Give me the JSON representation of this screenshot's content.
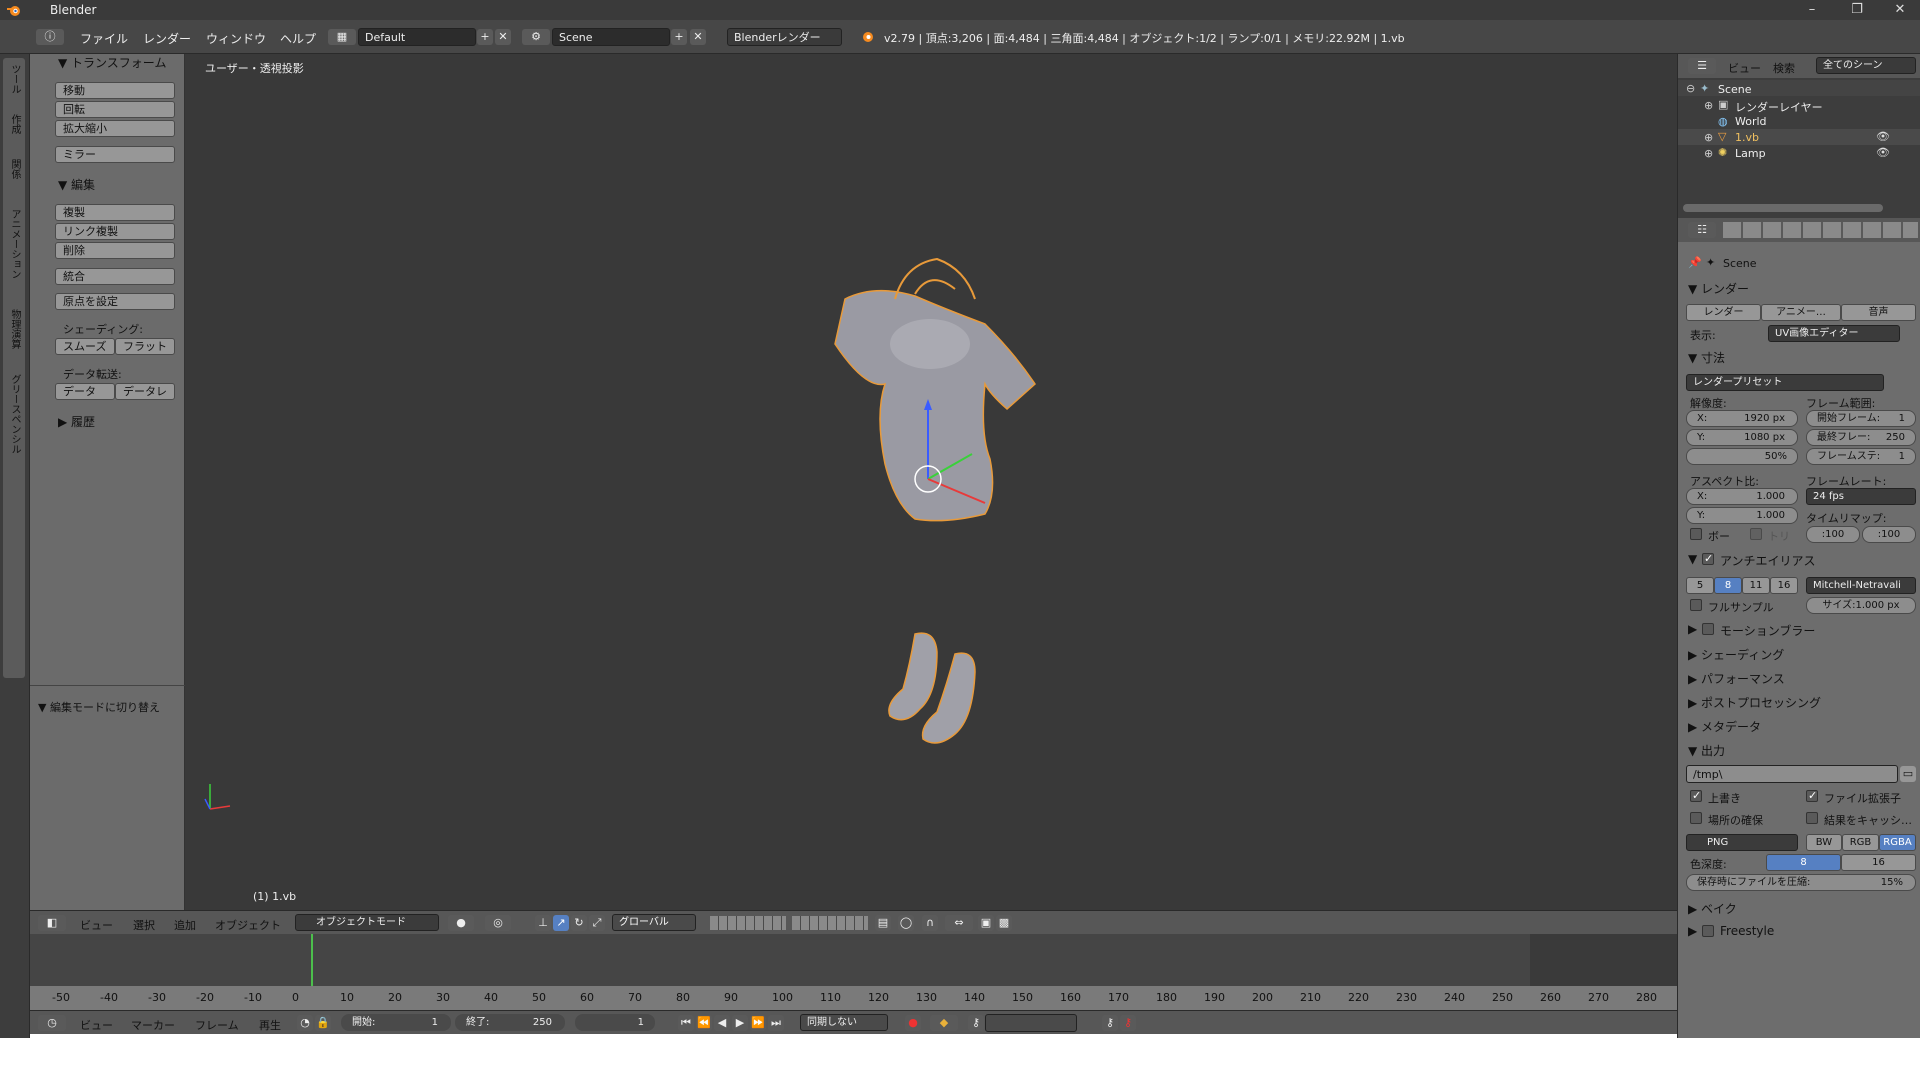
{
  "titlebar": {
    "app": "Blender",
    "min": "–",
    "max": "❐",
    "close": "✕"
  },
  "info": {
    "menus": [
      "ファイル",
      "レンダー",
      "ウィンドウ",
      "ヘルプ"
    ],
    "layout": "Default",
    "scene": "Scene",
    "engine": "Blenderレンダー",
    "stats": "v2.79 | 頂点:3,206 | 面:4,484 | 三角面:4,484 | オブジェクト:1/2 | ランプ:0/1 | メモリ:22.92M | 1.vb"
  },
  "leftstrip": {
    "tabs": [
      "ツール",
      "作成",
      "関係",
      "アニメーション",
      "物理演算",
      "グリースペンシル"
    ]
  },
  "toolshelf": {
    "transform_header": "▼ トランスフォーム",
    "transform": [
      "移動",
      "回転",
      "拡大縮小",
      "ミラー"
    ],
    "edit_header": "▼ 編集",
    "edit": [
      "複製",
      "リンク複製",
      "削除",
      "統合"
    ],
    "origin": "原点を設定",
    "shading_label": "シェーディング:",
    "smooth": "スムーズ",
    "flat": "フラット",
    "datatransfer_label": "データ転送:",
    "data": "データ",
    "data2": "データレ",
    "history": "▶ 履歴",
    "editmode": "▼ 編集モードに切り替え"
  },
  "viewport": {
    "label": "ユーザー・透視投影",
    "object": "(1) 1.vb"
  },
  "vphead": {
    "menus": [
      "ビュー",
      "選択",
      "追加",
      "オブジェクト"
    ],
    "mode": "オブジェクトモード",
    "orientation": "グローバル"
  },
  "timeline": {
    "ticks": [
      "-50",
      "-40",
      "-30",
      "-20",
      "-10",
      "0",
      "10",
      "20",
      "30",
      "40",
      "50",
      "60",
      "70",
      "80",
      "90",
      "100",
      "110",
      "120",
      "130",
      "140",
      "150",
      "160",
      "170",
      "180",
      "190",
      "200",
      "210",
      "220",
      "230",
      "240",
      "250",
      "260",
      "270",
      "280"
    ]
  },
  "tlfoot": {
    "menus": [
      "ビュー",
      "マーカー",
      "フレーム",
      "再生"
    ],
    "start_label": "開始:",
    "start": "1",
    "end_label": "終了:",
    "end": "250",
    "current": "1",
    "sync": "同期しない"
  },
  "outliner": {
    "menus": [
      "ビュー",
      "検索",
      "全てのシーン"
    ],
    "items": [
      "Scene",
      "レンダーレイヤー",
      "World",
      "1.vb",
      "Lamp"
    ]
  },
  "props": {
    "scene": "Scene",
    "render": "▼ レンダー",
    "render_btns": [
      "レンダー",
      "アニメー…",
      "音声"
    ],
    "display_label": "表示:",
    "display": "UV画像エディター",
    "dimensions": "▼ 寸法",
    "preset": "レンダープリセット",
    "res_label": "解像度:",
    "frange_label": "フレーム範囲:",
    "res_x": "X:",
    "res_x_val": "1920 px",
    "res_y": "Y:",
    "res_y_val": "1080 px",
    "res_pct": "50%",
    "fstart": "開始フレーム:",
    "fstart_val": "1",
    "fend": "最終フレー:",
    "fend_val": "250",
    "fstep": "フレームステ:",
    "fstep_val": "1",
    "aspect_label": "アスペクト比:",
    "fps_label": "フレームレート:",
    "asp_x": "X:",
    "asp_x_val": "1.000",
    "asp_y": "Y:",
    "asp_y_val": "1.000",
    "fps": "24 fps",
    "remap_label": "タイムリマップ:",
    "remap_old": ":100",
    "remap_new": ":100",
    "border": "ボー",
    "crop": "トリ",
    "aa": "アンチエイリアス",
    "aa_samples": [
      "5",
      "8",
      "11",
      "16"
    ],
    "aa_filter": "Mitchell-Netravali",
    "fullsample": "フルサンプル",
    "aa_size": "サイズ:1.000 px",
    "motionblur": "モーションブラー",
    "shading": "▶ シェーディング",
    "performance": "▶ パフォーマンス",
    "post": "▶ ポストプロセッシング",
    "metadata": "▶ メタデータ",
    "output": "▼ 出力",
    "path": "/tmp\\",
    "overwrite": "上書き",
    "ext": "ファイル拡張子",
    "placeholders": "場所の確保",
    "cache": "結果をキャッシ…",
    "format": "PNG",
    "bw": "BW",
    "rgb": "RGB",
    "rgba": "RGBA",
    "depth_label": "色深度:",
    "d8": "8",
    "d16": "16",
    "compress": "保存時にファイルを圧縮:",
    "compress_val": "15%",
    "bake": "▶ ベイク",
    "freestyle": "Freestyle"
  }
}
